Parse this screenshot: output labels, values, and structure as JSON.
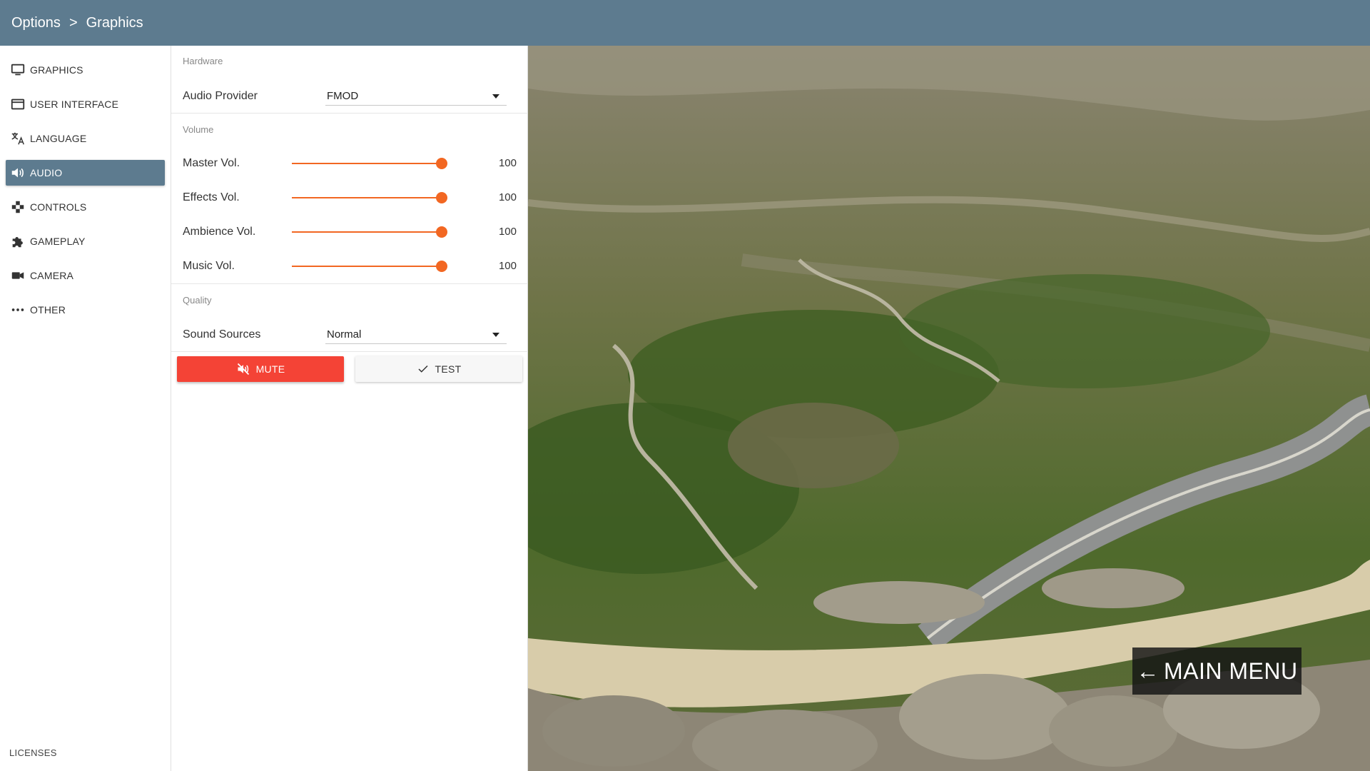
{
  "header": {
    "breadcrumb": [
      "Options",
      "Graphics"
    ],
    "separator": ">"
  },
  "sidebar": {
    "items": [
      {
        "label": "GRAPHICS",
        "icon": "monitor-icon",
        "active": false
      },
      {
        "label": "USER INTERFACE",
        "icon": "window-icon",
        "active": false
      },
      {
        "label": "LANGUAGE",
        "icon": "translate-icon",
        "active": false
      },
      {
        "label": "AUDIO",
        "icon": "speaker-icon",
        "active": true
      },
      {
        "label": "CONTROLS",
        "icon": "gamepad-icon",
        "active": false
      },
      {
        "label": "GAMEPLAY",
        "icon": "puzzle-icon",
        "active": false
      },
      {
        "label": "CAMERA",
        "icon": "video-camera-icon",
        "active": false
      },
      {
        "label": "OTHER",
        "icon": "more-dots-icon",
        "active": false
      }
    ],
    "footer_link": "LICENSES"
  },
  "audio": {
    "hardware": {
      "section": "Hardware",
      "audio_provider_label": "Audio Provider",
      "audio_provider_value": "FMOD"
    },
    "volume": {
      "section": "Volume",
      "sliders": [
        {
          "label": "Master Vol.",
          "value": "100",
          "fraction": 1.0
        },
        {
          "label": "Effects Vol.",
          "value": "100",
          "fraction": 1.0
        },
        {
          "label": "Ambience Vol.",
          "value": "100",
          "fraction": 1.0
        },
        {
          "label": "Music Vol.",
          "value": "100",
          "fraction": 1.0
        }
      ]
    },
    "quality": {
      "section": "Quality",
      "sound_sources_label": "Sound Sources",
      "sound_sources_value": "Normal"
    },
    "buttons": {
      "mute": "MUTE",
      "test": "TEST"
    }
  },
  "scene": {
    "main_menu_label": "MAIN MENU"
  },
  "colors": {
    "header": "#5d7b8f",
    "accent": "#f26722",
    "mute": "#f44336"
  }
}
